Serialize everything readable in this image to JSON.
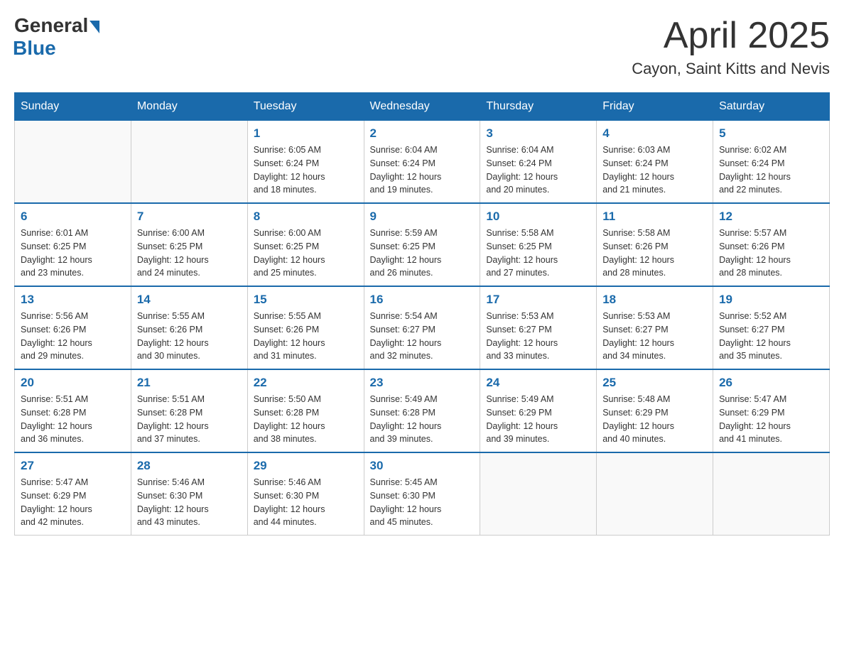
{
  "logo": {
    "general": "General",
    "blue": "Blue"
  },
  "title": {
    "month_year": "April 2025",
    "location": "Cayon, Saint Kitts and Nevis"
  },
  "headers": [
    "Sunday",
    "Monday",
    "Tuesday",
    "Wednesday",
    "Thursday",
    "Friday",
    "Saturday"
  ],
  "weeks": [
    [
      {
        "day": "",
        "info": ""
      },
      {
        "day": "",
        "info": ""
      },
      {
        "day": "1",
        "info": "Sunrise: 6:05 AM\nSunset: 6:24 PM\nDaylight: 12 hours\nand 18 minutes."
      },
      {
        "day": "2",
        "info": "Sunrise: 6:04 AM\nSunset: 6:24 PM\nDaylight: 12 hours\nand 19 minutes."
      },
      {
        "day": "3",
        "info": "Sunrise: 6:04 AM\nSunset: 6:24 PM\nDaylight: 12 hours\nand 20 minutes."
      },
      {
        "day": "4",
        "info": "Sunrise: 6:03 AM\nSunset: 6:24 PM\nDaylight: 12 hours\nand 21 minutes."
      },
      {
        "day": "5",
        "info": "Sunrise: 6:02 AM\nSunset: 6:24 PM\nDaylight: 12 hours\nand 22 minutes."
      }
    ],
    [
      {
        "day": "6",
        "info": "Sunrise: 6:01 AM\nSunset: 6:25 PM\nDaylight: 12 hours\nand 23 minutes."
      },
      {
        "day": "7",
        "info": "Sunrise: 6:00 AM\nSunset: 6:25 PM\nDaylight: 12 hours\nand 24 minutes."
      },
      {
        "day": "8",
        "info": "Sunrise: 6:00 AM\nSunset: 6:25 PM\nDaylight: 12 hours\nand 25 minutes."
      },
      {
        "day": "9",
        "info": "Sunrise: 5:59 AM\nSunset: 6:25 PM\nDaylight: 12 hours\nand 26 minutes."
      },
      {
        "day": "10",
        "info": "Sunrise: 5:58 AM\nSunset: 6:25 PM\nDaylight: 12 hours\nand 27 minutes."
      },
      {
        "day": "11",
        "info": "Sunrise: 5:58 AM\nSunset: 6:26 PM\nDaylight: 12 hours\nand 28 minutes."
      },
      {
        "day": "12",
        "info": "Sunrise: 5:57 AM\nSunset: 6:26 PM\nDaylight: 12 hours\nand 28 minutes."
      }
    ],
    [
      {
        "day": "13",
        "info": "Sunrise: 5:56 AM\nSunset: 6:26 PM\nDaylight: 12 hours\nand 29 minutes."
      },
      {
        "day": "14",
        "info": "Sunrise: 5:55 AM\nSunset: 6:26 PM\nDaylight: 12 hours\nand 30 minutes."
      },
      {
        "day": "15",
        "info": "Sunrise: 5:55 AM\nSunset: 6:26 PM\nDaylight: 12 hours\nand 31 minutes."
      },
      {
        "day": "16",
        "info": "Sunrise: 5:54 AM\nSunset: 6:27 PM\nDaylight: 12 hours\nand 32 minutes."
      },
      {
        "day": "17",
        "info": "Sunrise: 5:53 AM\nSunset: 6:27 PM\nDaylight: 12 hours\nand 33 minutes."
      },
      {
        "day": "18",
        "info": "Sunrise: 5:53 AM\nSunset: 6:27 PM\nDaylight: 12 hours\nand 34 minutes."
      },
      {
        "day": "19",
        "info": "Sunrise: 5:52 AM\nSunset: 6:27 PM\nDaylight: 12 hours\nand 35 minutes."
      }
    ],
    [
      {
        "day": "20",
        "info": "Sunrise: 5:51 AM\nSunset: 6:28 PM\nDaylight: 12 hours\nand 36 minutes."
      },
      {
        "day": "21",
        "info": "Sunrise: 5:51 AM\nSunset: 6:28 PM\nDaylight: 12 hours\nand 37 minutes."
      },
      {
        "day": "22",
        "info": "Sunrise: 5:50 AM\nSunset: 6:28 PM\nDaylight: 12 hours\nand 38 minutes."
      },
      {
        "day": "23",
        "info": "Sunrise: 5:49 AM\nSunset: 6:28 PM\nDaylight: 12 hours\nand 39 minutes."
      },
      {
        "day": "24",
        "info": "Sunrise: 5:49 AM\nSunset: 6:29 PM\nDaylight: 12 hours\nand 39 minutes."
      },
      {
        "day": "25",
        "info": "Sunrise: 5:48 AM\nSunset: 6:29 PM\nDaylight: 12 hours\nand 40 minutes."
      },
      {
        "day": "26",
        "info": "Sunrise: 5:47 AM\nSunset: 6:29 PM\nDaylight: 12 hours\nand 41 minutes."
      }
    ],
    [
      {
        "day": "27",
        "info": "Sunrise: 5:47 AM\nSunset: 6:29 PM\nDaylight: 12 hours\nand 42 minutes."
      },
      {
        "day": "28",
        "info": "Sunrise: 5:46 AM\nSunset: 6:30 PM\nDaylight: 12 hours\nand 43 minutes."
      },
      {
        "day": "29",
        "info": "Sunrise: 5:46 AM\nSunset: 6:30 PM\nDaylight: 12 hours\nand 44 minutes."
      },
      {
        "day": "30",
        "info": "Sunrise: 5:45 AM\nSunset: 6:30 PM\nDaylight: 12 hours\nand 45 minutes."
      },
      {
        "day": "",
        "info": ""
      },
      {
        "day": "",
        "info": ""
      },
      {
        "day": "",
        "info": ""
      }
    ]
  ]
}
